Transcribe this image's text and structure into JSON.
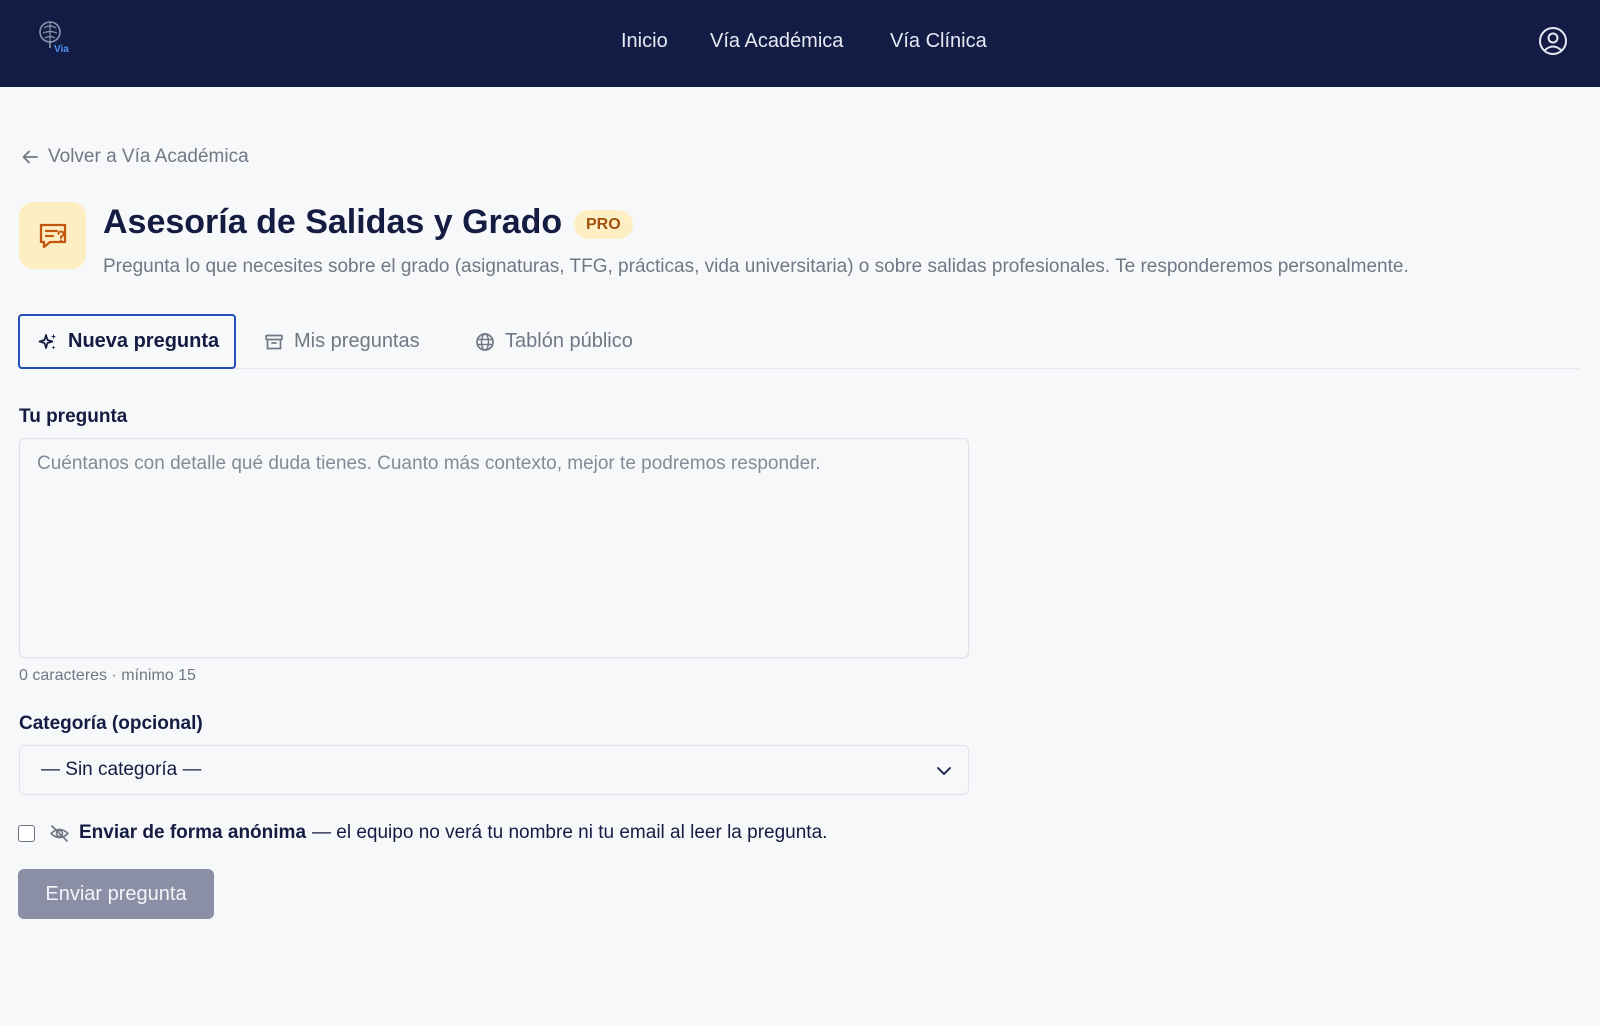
{
  "nav": {
    "logo_text": "Via",
    "links": [
      "Inicio",
      "Vía Académica",
      "Vía Clínica"
    ]
  },
  "back_link": "Volver a Vía Académica",
  "header": {
    "title": "Asesoría de Salidas y Grado",
    "badge": "PRO",
    "subtitle": "Pregunta lo que necesites sobre el grado (asignaturas, TFG, prácticas, vida universitaria) o sobre salidas profesionales. Te responderemos personalmente."
  },
  "tabs": [
    {
      "label": "Nueva pregunta",
      "icon": "sparkles-icon",
      "active": true
    },
    {
      "label": "Mis preguntas",
      "icon": "archive-icon",
      "active": false
    },
    {
      "label": "Tablón público",
      "icon": "globe-icon",
      "active": false
    }
  ],
  "form": {
    "question_label": "Tu pregunta",
    "question_value": "",
    "question_placeholder": "Cuéntanos con detalle qué duda tienes. Cuanto más contexto, mejor te podremos responder.",
    "char_count": "0 caracteres · mínimo 15",
    "category_label": "Categoría (opcional)",
    "category_value": "— Sin categoría —",
    "anonymous_strong": "Enviar de forma anónima",
    "anonymous_rest": "— el equipo no verá tu nombre ni tu email al leer la pregunta.",
    "anonymous_checked": false,
    "submit_label": "Enviar pregunta"
  },
  "colors": {
    "topbar": "#121c45",
    "accent": "#2350b8",
    "badge_bg": "#fdefc3",
    "badge_text": "#a3500e",
    "button_disabled": "#8a8fa6"
  }
}
